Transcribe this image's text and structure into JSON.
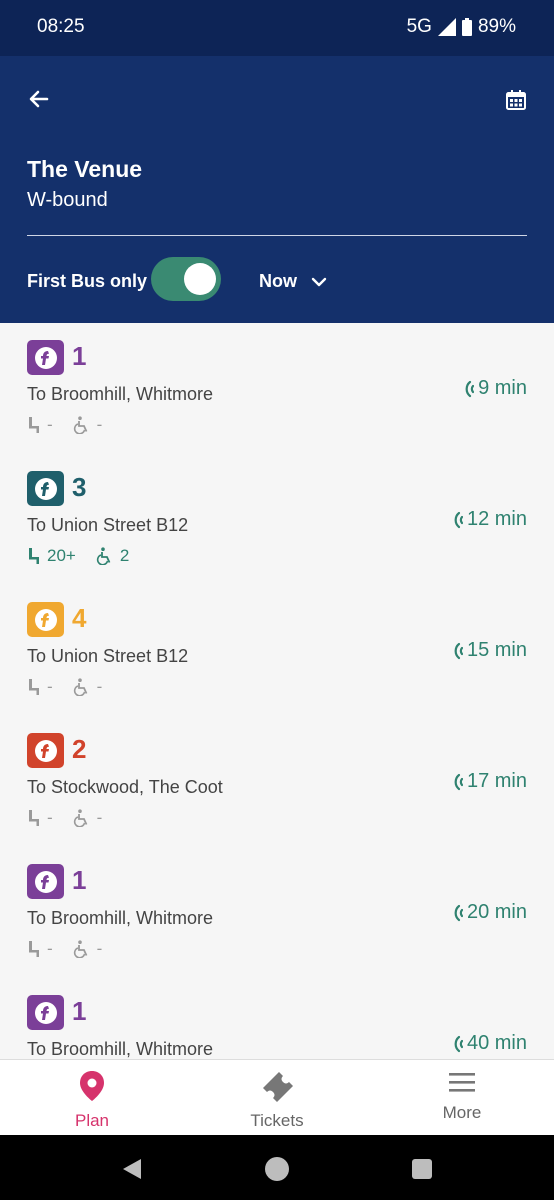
{
  "status": {
    "time": "08:25",
    "network": "5G",
    "battery": "89%"
  },
  "header": {
    "stop_name": "The Venue",
    "direction": "W-bound",
    "filter_label": "First Bus only",
    "filter_on": true,
    "time_filter": "Now"
  },
  "departures": [
    {
      "route": "1",
      "color": "#7b3f98",
      "destination": "To Broomhill, Whitmore",
      "seats": "-",
      "wheelchair": "-",
      "eta": "9 min"
    },
    {
      "route": "3",
      "color": "#1f5f6b",
      "destination": "To Union Street B12",
      "seats": "20+",
      "wheelchair": "2",
      "eta": "12 min"
    },
    {
      "route": "4",
      "color": "#f0a830",
      "destination": "To Union Street B12",
      "seats": "-",
      "wheelchair": "-",
      "eta": "15 min"
    },
    {
      "route": "2",
      "color": "#d1432b",
      "destination": "To Stockwood, The Coot",
      "seats": "-",
      "wheelchair": "-",
      "eta": "17 min"
    },
    {
      "route": "1",
      "color": "#7b3f98",
      "destination": "To Broomhill, Whitmore",
      "seats": "-",
      "wheelchair": "-",
      "eta": "20 min"
    },
    {
      "route": "1",
      "color": "#7b3f98",
      "destination": "To Broomhill, Whitmore",
      "seats": "",
      "wheelchair": "",
      "eta": "40 min"
    }
  ],
  "nav": {
    "plan": "Plan",
    "tickets": "Tickets",
    "more": "More"
  },
  "colors": {
    "header_bg": "#14306b",
    "status_bg": "#0d2456",
    "toggle_on": "#3a8a72",
    "eta": "#2f8270",
    "plan_active": "#d6336c"
  }
}
